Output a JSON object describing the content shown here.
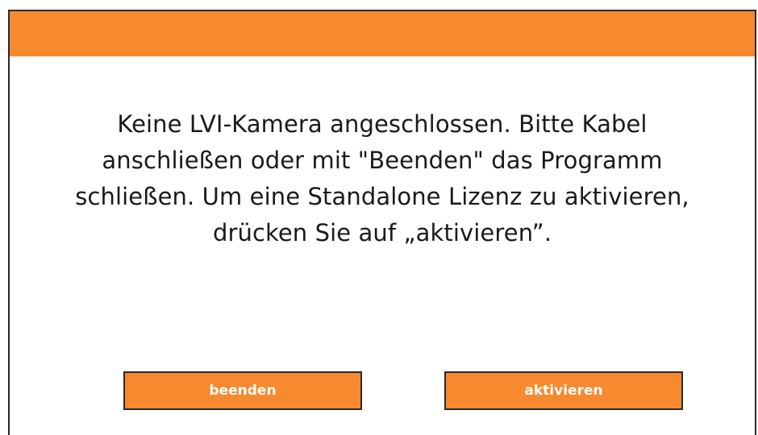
{
  "dialog": {
    "title_bar_color": "#f7892f",
    "message_lines": [
      "Keine LVI-Kamera angeschlossen. Bitte Kabel",
      "anschließen oder mit \"Beenden\" das Programm",
      "schließen. Um eine Standalone Lizenz zu aktivieren,",
      "drücken Sie auf „aktivieren”."
    ],
    "buttons": {
      "quit_label": "beenden",
      "activate_label": "aktivieren"
    }
  }
}
